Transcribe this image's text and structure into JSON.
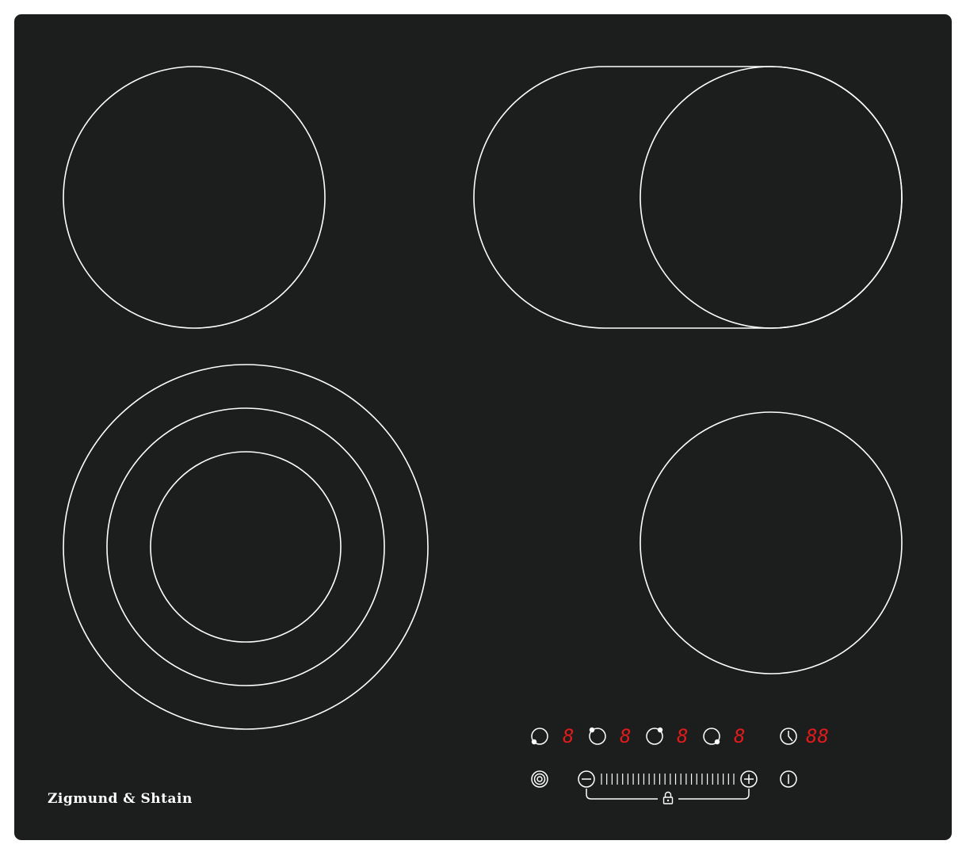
{
  "brand": {
    "name": "Zigmund & Shtain"
  },
  "colors": {
    "glass": "#1c1d1d",
    "outline": "#ffffff",
    "display": "#e01b1b",
    "background": "#ffffff"
  },
  "zones": [
    {
      "id": "rear-left",
      "type": "single"
    },
    {
      "id": "rear-right",
      "type": "oval-extension"
    },
    {
      "id": "front-left",
      "type": "triple-ring"
    },
    {
      "id": "front-right",
      "type": "single"
    }
  ],
  "control_panel": {
    "zone_buttons": [
      {
        "icon": "zone-front-left-icon",
        "display": "8"
      },
      {
        "icon": "zone-rear-left-icon",
        "display": "8"
      },
      {
        "icon": "zone-rear-right-icon",
        "display": "8"
      },
      {
        "icon": "zone-front-right-icon",
        "display": "8"
      }
    ],
    "timer": {
      "icon": "timer-icon",
      "display": "88"
    },
    "bottom_row": {
      "multi_zone_icon": "multi-ring-icon",
      "minus_icon": "minus-icon",
      "plus_icon": "plus-icon",
      "lock_icon": "lock-icon",
      "power_icon": "power-icon"
    }
  }
}
